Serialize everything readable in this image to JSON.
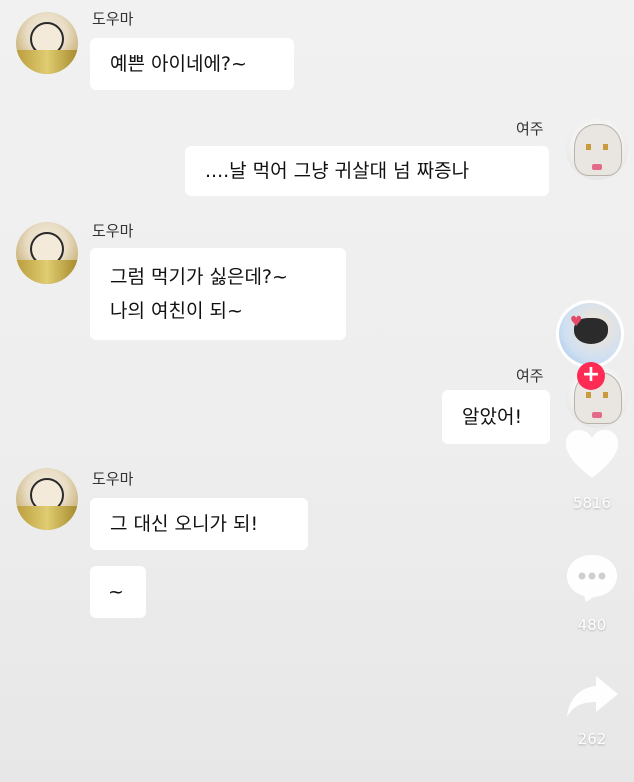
{
  "messages": [
    {
      "sender": "도우마",
      "side": "left",
      "bubbles": [
        "예쁜 아이네에?~"
      ]
    },
    {
      "sender": "여주",
      "side": "right",
      "bubbles": [
        "....날 먹어 그냥 귀살대 넘  짜증나"
      ]
    },
    {
      "sender": "도우마",
      "side": "left",
      "bubbles": [
        "그럼 먹기가 싫은데?~",
        "나의 여친이 되~"
      ]
    },
    {
      "sender": "여주",
      "side": "right",
      "bubbles": [
        "알았어!"
      ]
    },
    {
      "sender": "도우마",
      "side": "left",
      "bubbles": [
        "그 대신 오니가 되!",
        "~"
      ]
    }
  ],
  "tiktok": {
    "like_count": "5816",
    "comment_count": "480",
    "share_count": "262",
    "follow_symbol": "+",
    "colors": {
      "follow": "#fe2c55",
      "avatar_ring": "#ffffff"
    }
  },
  "icons": [
    "creator-avatar",
    "heart-icon",
    "comment-icon",
    "share-icon",
    "plus-icon"
  ]
}
